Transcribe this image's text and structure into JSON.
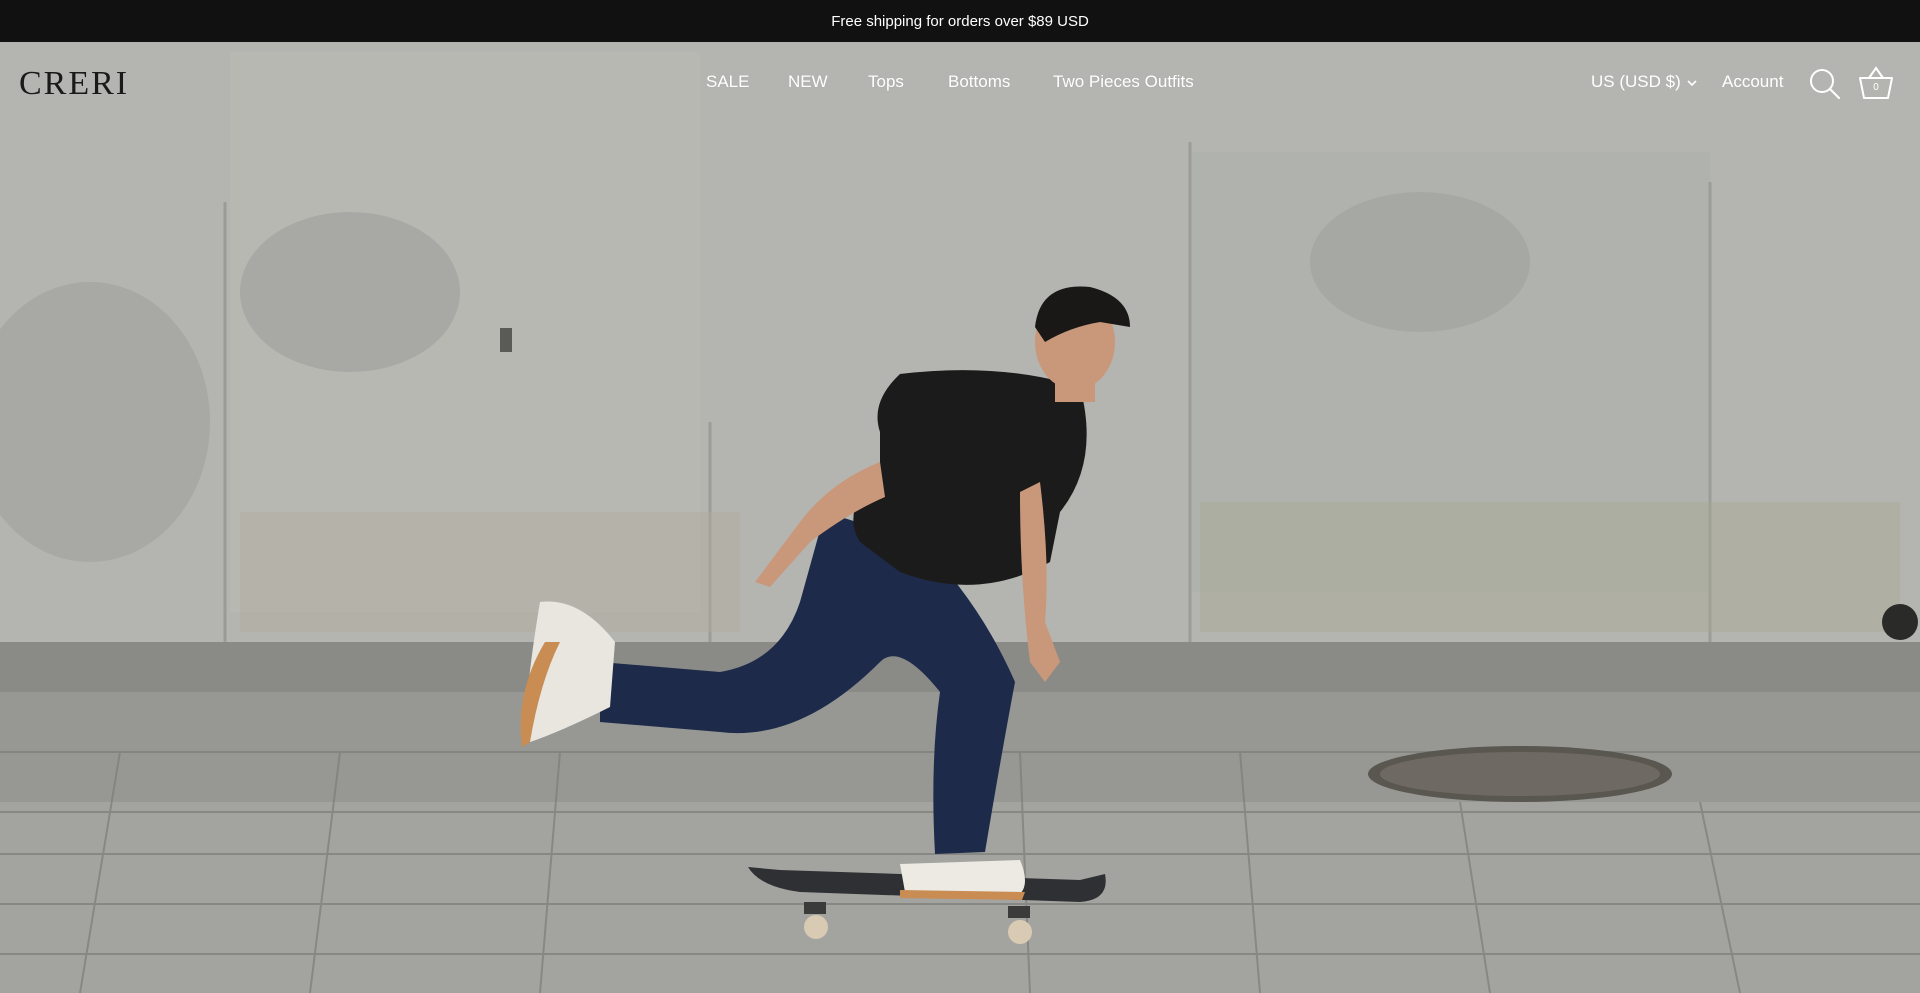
{
  "announcement": {
    "text": "Free shipping for orders over $89 USD"
  },
  "header": {
    "logo": "CRERI",
    "nav": [
      {
        "label": "SALE"
      },
      {
        "label": "NEW"
      },
      {
        "label": "Tops"
      },
      {
        "label": "Bottoms"
      },
      {
        "label": "Two Pieces Outfits"
      }
    ],
    "currency": {
      "label": "US (USD $)"
    },
    "account_label": "Account",
    "cart_count": "0"
  },
  "colors": {
    "announcement_bg": "#111111",
    "nav_text": "#ffffff",
    "logo_text": "#1a1a1a"
  },
  "icons": {
    "search": "search-icon",
    "cart": "basket-icon",
    "currency_chevron": "chevron-down-icon"
  },
  "hero": {
    "image": "skateboarder-in-black-tee-and-dark-denim-against-concrete-wall"
  }
}
